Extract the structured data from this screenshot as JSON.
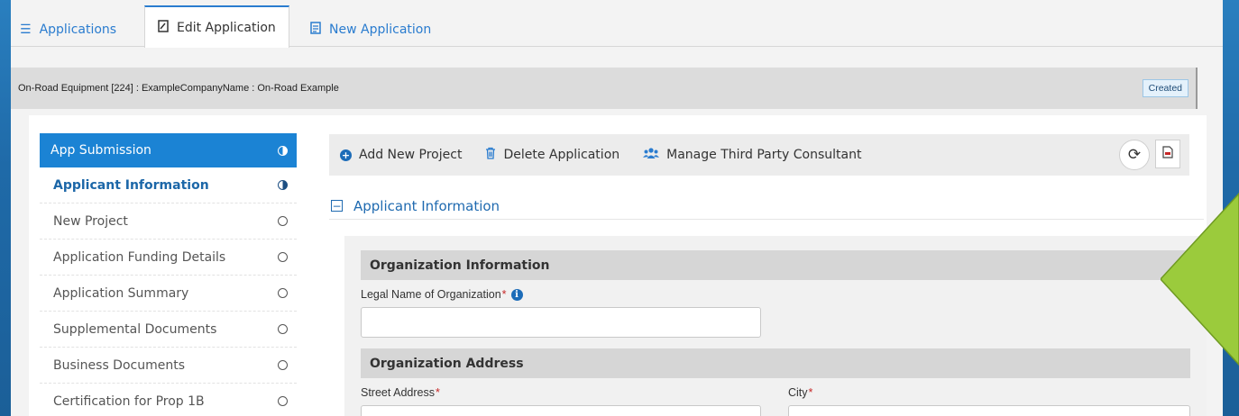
{
  "tabs": [
    {
      "label": "Applications",
      "icon": "list-icon"
    },
    {
      "label": "Edit Application",
      "icon": "edit-file-icon"
    },
    {
      "label": "New Application",
      "icon": "file-text-icon"
    }
  ],
  "header": {
    "breadcrumb": "On-Road Equipment [224] : ExampleCompanyName : On-Road Example",
    "status": "Created"
  },
  "sidebar": {
    "title": "App Submission",
    "items": [
      {
        "label": "Applicant Information"
      },
      {
        "label": "New Project"
      },
      {
        "label": "Application Funding Details"
      },
      {
        "label": "Application Summary"
      },
      {
        "label": "Supplemental Documents"
      },
      {
        "label": "Business Documents"
      },
      {
        "label": "Certification for Prop 1B"
      }
    ]
  },
  "toolbar": {
    "add_project": "Add New Project",
    "delete_application": "Delete Application",
    "manage_consultant": "Manage Third Party Consultant"
  },
  "section": {
    "title": "Applicant Information"
  },
  "form": {
    "org_info_title": "Organization Information",
    "legal_name_label": "Legal Name of Organization",
    "legal_name_value": "",
    "org_address_title": "Organization Address",
    "street_label": "Street Address",
    "city_label": "City",
    "required_mark": "*"
  },
  "colors": {
    "accent": "#1b83d4",
    "link": "#2a7ccf",
    "arrow": "#9bcb3c"
  }
}
